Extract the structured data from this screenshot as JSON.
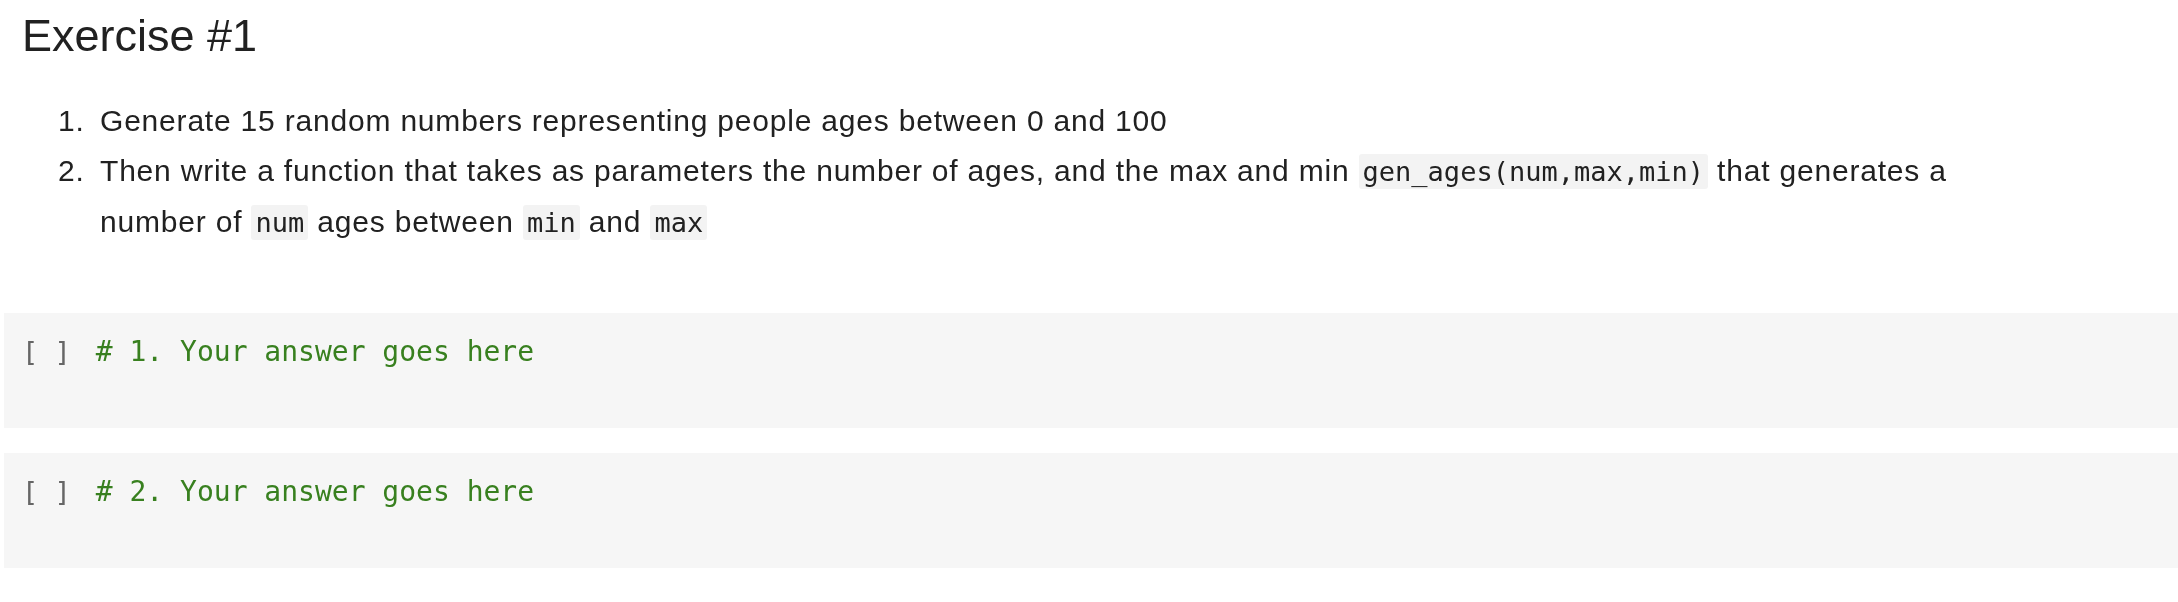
{
  "heading": "Exercise #1",
  "instructions": [
    {
      "number": "1.",
      "segments": [
        {
          "kind": "text",
          "text": "Generate 15 random numbers representing people ages between 0 and 100"
        }
      ]
    },
    {
      "number": "2.",
      "segments": [
        {
          "kind": "text",
          "text": "Then write a function that takes as parameters the number of ages, and the max and min "
        },
        {
          "kind": "code",
          "text": "gen_ages(num,max,min)"
        },
        {
          "kind": "text",
          "text": " that generates a number of "
        },
        {
          "kind": "code",
          "text": "num"
        },
        {
          "kind": "text",
          "text": " ages between "
        },
        {
          "kind": "code",
          "text": "min"
        },
        {
          "kind": "text",
          "text": " and "
        },
        {
          "kind": "code",
          "text": "max"
        }
      ]
    }
  ],
  "code_cells": [
    {
      "prompt": "[ ]",
      "source": "# 1. Your answer goes here"
    },
    {
      "prompt": "[ ]",
      "source": "# 2. Your answer goes here"
    }
  ]
}
